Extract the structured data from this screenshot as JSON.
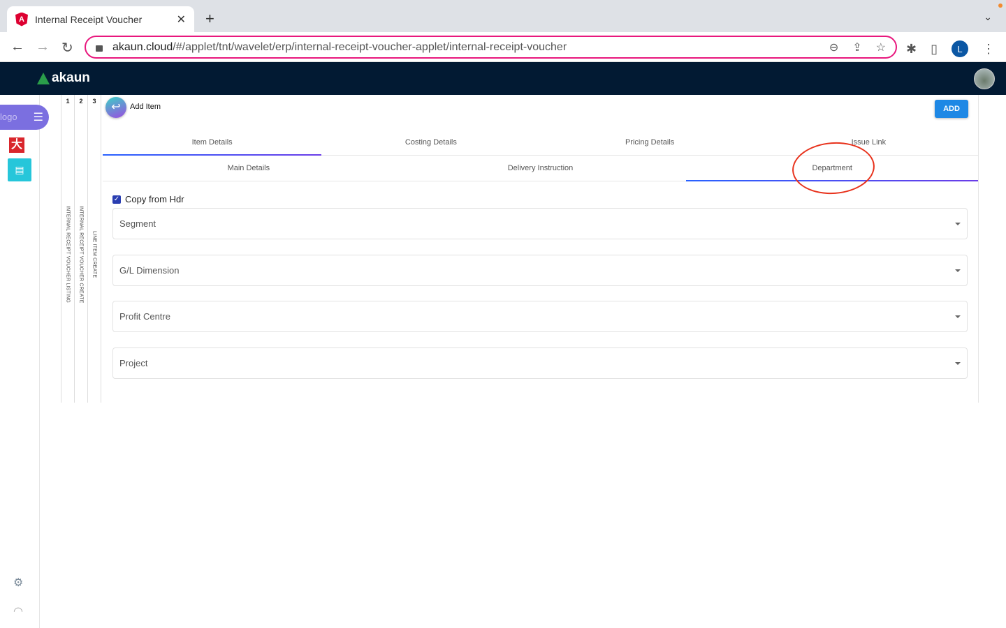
{
  "browser": {
    "tab_title": "Internal Receipt Voucher",
    "url_host": "akaun.cloud",
    "url_path": "/#/applet/tnt/wavelet/erp/internal-receipt-voucher-applet/internal-receipt-voucher",
    "profile_initial": "L"
  },
  "header": {
    "brand": "akaun"
  },
  "sidebar": {
    "logo_alt": "logo"
  },
  "breadcrumbs": [
    {
      "num": "1",
      "label": "INTERNAL RECEIPT VOUCHER LISTING"
    },
    {
      "num": "2",
      "label": "INTERNAL RECEIPT VOUCHER CREATE"
    },
    {
      "num": "3",
      "label": "LINE ITEM CREATE"
    }
  ],
  "main": {
    "title": "Add Item",
    "add_label": "ADD",
    "tabs_primary": [
      "Item Details",
      "Costing Details",
      "Pricing Details",
      "Issue Link"
    ],
    "tabs_secondary": [
      "Main Details",
      "Delivery Instruction",
      "Department"
    ],
    "copy_from_hdr": {
      "label": "Copy from Hdr",
      "checked": true
    },
    "fields": [
      "Segment",
      "G/L Dimension",
      "Profit Centre",
      "Project"
    ]
  }
}
